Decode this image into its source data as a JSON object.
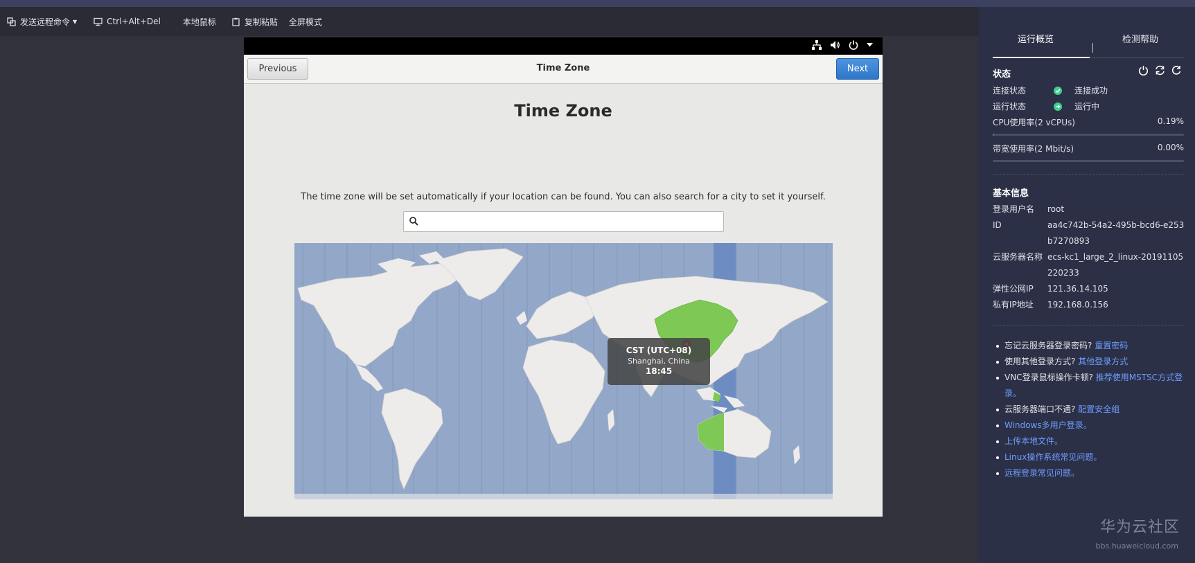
{
  "toolbar": {
    "send_remote_cmd": "发送远程命令",
    "ctrl_alt_del": "Ctrl+Alt+Del",
    "local_mouse": "本地鼠标",
    "copy_paste": "复制粘贴",
    "fullscreen": "全屏模式"
  },
  "installer": {
    "previous_label": "Previous",
    "header_title": "Time Zone",
    "next_label": "Next",
    "heading": "Time Zone",
    "description": "The time zone will be set automatically if your location can be found. You can also search for a city to set it yourself.",
    "search_value": "",
    "tooltip": {
      "zone": "CST (UTC+08)",
      "city": "Shanghai, China",
      "time": "18:45"
    }
  },
  "panel": {
    "tabs": [
      "运行概览",
      "检测帮助"
    ],
    "status_title": "状态",
    "status": {
      "conn_label": "连接状态",
      "conn_value": "连接成功",
      "run_label": "运行状态",
      "run_value": "运行中",
      "cpu_label": "CPU使用率(2 vCPUs)",
      "cpu_value": "0.19%",
      "cpu_fraction": 0.0019,
      "bw_label": "带宽使用率(2 Mbit/s)",
      "bw_value": "0.00%",
      "bw_fraction": 0.0
    },
    "basic_title": "基本信息",
    "basic": [
      {
        "k": "登录用户名",
        "v": "root"
      },
      {
        "k": "ID",
        "v": "aa4c742b-54a2-495b-bcd6-e253b7270893"
      },
      {
        "k": "云服务器名称",
        "v": "ecs-kc1_large_2_linux-20191105220233"
      },
      {
        "k": "弹性公网IP",
        "v": "121.36.14.105"
      },
      {
        "k": "私有IP地址",
        "v": "192.168.0.156"
      }
    ],
    "help": [
      {
        "text": "忘记云服务器登录密码?",
        "link": "重置密码"
      },
      {
        "text": "使用其他登录方式?",
        "link": "其他登录方式"
      },
      {
        "text": "VNC登录鼠标操作卡顿?",
        "link": "推荐使用MSTSC方式登录。"
      },
      {
        "text": "云服务器端口不通?",
        "link": "配置安全组"
      },
      {
        "text": "",
        "link": "Windows多用户登录。"
      },
      {
        "text": "",
        "link": "上传本地文件。"
      },
      {
        "text": "",
        "link": "Linux操作系统常见问题。"
      },
      {
        "text": "",
        "link": "远程登录常见问题。"
      }
    ],
    "watermark": "华为云社区",
    "watermark_url": "bbs.huaweicloud.com"
  },
  "colors": {
    "panel_bg": "#2c3046",
    "accent_link": "#6d9cff",
    "ok_green": "#3ccf8e",
    "next_blue": "#3a82d6",
    "map_water": "#93a8c8",
    "map_highlight": "#7ec855"
  }
}
